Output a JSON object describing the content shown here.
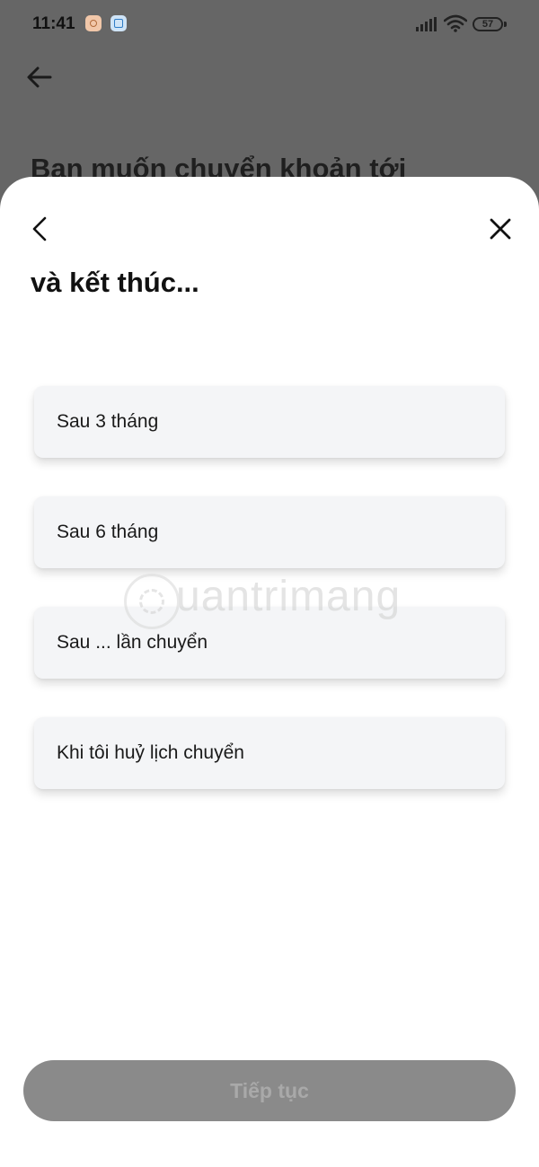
{
  "status_bar": {
    "time": "11:41",
    "battery": "57",
    "icons": [
      "notification-app-icon",
      "notification-app-icon",
      "signal-icon",
      "wifi-icon",
      "battery-icon"
    ]
  },
  "background": {
    "heading": "Bạn muốn chuyển khoản tới"
  },
  "sheet": {
    "title": "và kết thúc...",
    "options": [
      {
        "label": "Sau 3 tháng"
      },
      {
        "label": "Sau 6 tháng"
      },
      {
        "label": "Sau ... lần chuyển"
      },
      {
        "label": "Khi tôi huỷ lịch chuyển"
      }
    ],
    "continue_label": "Tiếp tục"
  },
  "watermark": {
    "text": "uantrimang"
  },
  "colors": {
    "overlay": "#666666",
    "sheet_bg": "#ffffff",
    "option_bg": "#f4f5f7",
    "button_disabled_bg": "#8a8a8a",
    "button_disabled_text": "#a9a9a9"
  }
}
